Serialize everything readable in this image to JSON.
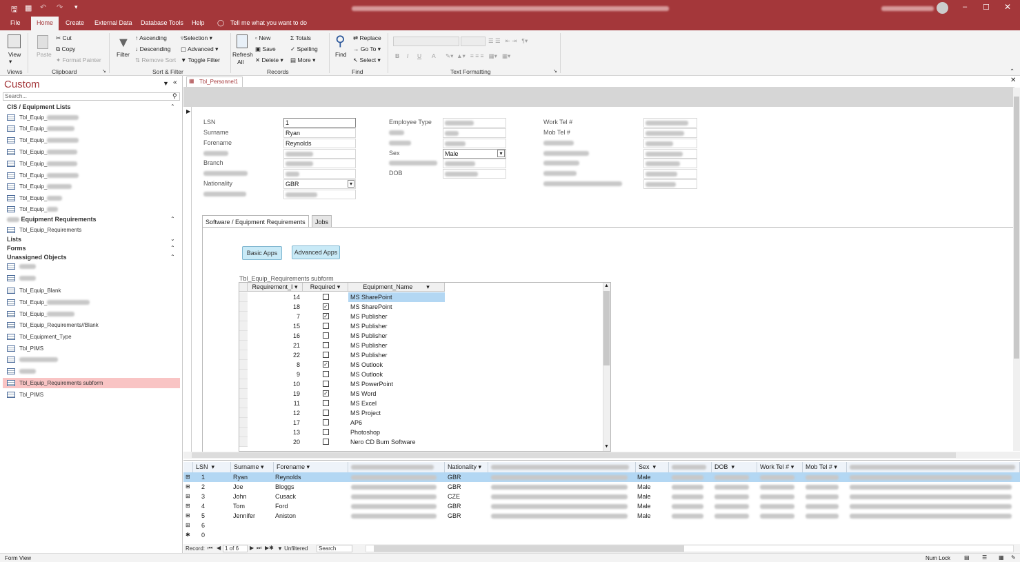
{
  "window": {
    "title_blurred": true
  },
  "menu": [
    "File",
    "Home",
    "Create",
    "External Data",
    "Database Tools",
    "Help",
    "Tell me what you want to do"
  ],
  "ribbon": {
    "views": {
      "view": "View",
      "group": "Views"
    },
    "clipboard": {
      "paste": "Paste",
      "cut": "Cut",
      "copy": "Copy",
      "format_painter": "Format Painter",
      "group": "Clipboard"
    },
    "sort": {
      "filter": "Filter",
      "ascending": "Ascending",
      "descending": "Descending",
      "remove_sort": "Remove Sort",
      "selection": "Selection",
      "advanced": "Advanced",
      "toggle": "Toggle Filter",
      "group": "Sort & Filter"
    },
    "records": {
      "refresh": "Refresh",
      "all": "All",
      "new": "New",
      "save": "Save",
      "delete": "Delete",
      "totals": "Totals",
      "spelling": "Spelling",
      "more": "More",
      "group": "Records"
    },
    "find": {
      "find": "Find",
      "replace": "Replace",
      "goto": "Go To",
      "select": "Select",
      "group": "Find"
    },
    "text": {
      "b": "B",
      "i": "I",
      "u": "U",
      "a": "A",
      "group": "Text Formatting"
    }
  },
  "nav": {
    "title": "Custom",
    "search_placeholder": "Search...",
    "cat1": "CIS / Equipment Lists",
    "eq_prefix": "Tbl_Equip_",
    "eqreq_cat": "Equipment Requirements",
    "eqreq_item": "Tbl_Equip_Requirements",
    "lists": "Lists",
    "forms": "Forms",
    "unassigned": "Unassigned Objects",
    "u_blank": "Tbl_Equip_Blank",
    "u_reqblank": "Tbl_Equip_Requirements//Blank",
    "u_eqtype": "Tbl_Equipment_Type",
    "u_pims": "Tbl_PIMS",
    "u_subform": "Tbl_Equip_Requirements subform",
    "u_pims2": "Tbl_PIMS"
  },
  "doc": {
    "tab": "Tbl_Personnel1"
  },
  "form": {
    "lsn_label": "LSN",
    "lsn_value": "1",
    "surname_label": "Surname",
    "surname_value": "Ryan",
    "forename_label": "Forename",
    "forename_value": "Reynolds",
    "branch_label": "Branch",
    "nationality_label": "Nationality",
    "nationality_value": "GBR",
    "emptype_label": "Employee Type",
    "sex_label": "Sex",
    "sex_value": "Male",
    "dob_label": "DOB",
    "worktel_label": "Work Tel #",
    "mobtel_label": "Mob Tel #"
  },
  "tabs": {
    "t1": "Software / Equipment Requirements",
    "t2": "Jobs"
  },
  "buttons": {
    "basic": "Basic Apps",
    "advanced": "Advanced Apps"
  },
  "subform": {
    "label": "Tbl_Equip_Requirements subform",
    "headers": [
      "Requirement_I",
      "Required",
      "Equipment_Name"
    ],
    "rows": [
      {
        "id": "14",
        "req": false,
        "name": "MS SharePoint"
      },
      {
        "id": "18",
        "req": true,
        "name": "MS SharePoint"
      },
      {
        "id": "7",
        "req": true,
        "name": "MS Publisher"
      },
      {
        "id": "15",
        "req": false,
        "name": "MS Publisher"
      },
      {
        "id": "16",
        "req": false,
        "name": "MS Publisher"
      },
      {
        "id": "21",
        "req": false,
        "name": "MS Publisher"
      },
      {
        "id": "22",
        "req": false,
        "name": "MS Publisher"
      },
      {
        "id": "8",
        "req": true,
        "name": "MS Outlook"
      },
      {
        "id": "9",
        "req": false,
        "name": "MS Outlook"
      },
      {
        "id": "10",
        "req": false,
        "name": "MS PowerPoint"
      },
      {
        "id": "19",
        "req": true,
        "name": "MS Word"
      },
      {
        "id": "11",
        "req": false,
        "name": "MS Excel"
      },
      {
        "id": "12",
        "req": false,
        "name": "MS Project"
      },
      {
        "id": "17",
        "req": false,
        "name": "AP6"
      },
      {
        "id": "13",
        "req": false,
        "name": "Photoshop"
      },
      {
        "id": "20",
        "req": false,
        "name": "Nero CD Burn  Software"
      }
    ]
  },
  "datasheet": {
    "headers": {
      "lsn": "LSN",
      "surname": "Surname",
      "forename": "Forename",
      "nationality": "Nationality",
      "sex": "Sex",
      "dob": "DOB",
      "worktel": "Work Tel #",
      "mobtel": "Mob Tel #"
    },
    "rows": [
      {
        "lsn": "1",
        "surname": "Ryan",
        "forename": "Reynolds",
        "nat": "GBR",
        "sex": "Male"
      },
      {
        "lsn": "2",
        "surname": "Joe",
        "forename": "Bloggs",
        "nat": "GBR",
        "sex": "Male"
      },
      {
        "lsn": "3",
        "surname": "John",
        "forename": "Cusack",
        "nat": "CZE",
        "sex": "Male"
      },
      {
        "lsn": "4",
        "surname": "Tom",
        "forename": "Ford",
        "nat": "GBR",
        "sex": "Male"
      },
      {
        "lsn": "5",
        "surname": "Jennifer",
        "forename": "Aniston",
        "nat": "GBR",
        "sex": "Male"
      },
      {
        "lsn": "6",
        "surname": "",
        "forename": "",
        "nat": "",
        "sex": ""
      },
      {
        "lsn": "0",
        "surname": "",
        "forename": "",
        "nat": "",
        "sex": ""
      }
    ]
  },
  "recnav": {
    "record_label": "Record:",
    "position": "1 of 6",
    "filter": "Unfiltered",
    "search": "Search"
  },
  "status": {
    "left": "Form View",
    "numlock": "Num Lock"
  },
  "colors": {
    "accent": "#a4373a",
    "selected_row": "#b3d7f3",
    "nav_highlight": "#f9c4c4"
  }
}
